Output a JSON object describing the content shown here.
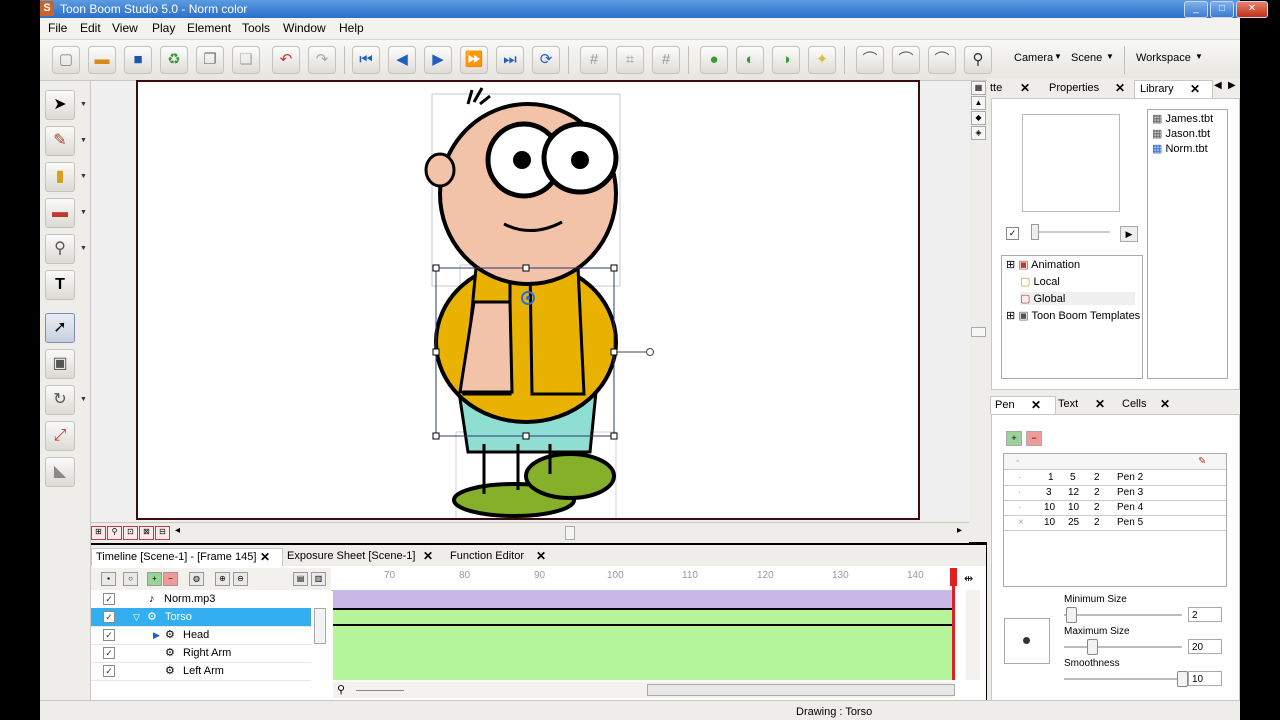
{
  "window": {
    "title": "Toon Boom Studio 5.0 - Norm color",
    "app_icon": "S"
  },
  "menu": [
    "File",
    "Edit",
    "View",
    "Play",
    "Element",
    "Tools",
    "Window",
    "Help"
  ],
  "toolbar": {
    "camera_label": "Camera",
    "scene_label": "Scene",
    "workspace_label": "Workspace"
  },
  "bottom_tabs": {
    "timeline": "Timeline [Scene-1] - [Frame 145]",
    "exposure": "Exposure Sheet [Scene-1]",
    "function": "Function Editor"
  },
  "timeline": {
    "ruler": [
      "70",
      "80",
      "90",
      "100",
      "110",
      "120",
      "130",
      "140"
    ],
    "layers": [
      {
        "name": "Norm.mp3",
        "checked": true
      },
      {
        "name": "Torso",
        "checked": true,
        "selected": true
      },
      {
        "name": "Head",
        "checked": true
      },
      {
        "name": "Right Arm",
        "checked": true
      },
      {
        "name": "Left Arm",
        "checked": true
      }
    ]
  },
  "right_tabs_top": {
    "tab1": "tte",
    "tab2": "Properties",
    "tab3": "Library"
  },
  "library": {
    "files": [
      "James.tbt",
      "Jason.tbt",
      "Norm.tbt"
    ],
    "tree": [
      "Animation",
      "Local",
      "Global",
      "Toon Boom Templates"
    ]
  },
  "right_tabs_bottom": {
    "tab1": "Pen",
    "tab2": "Text",
    "tab3": "Cells"
  },
  "pens": [
    {
      "a": "1",
      "b": "5",
      "c": "2",
      "name": "Pen 2"
    },
    {
      "a": "3",
      "b": "12",
      "c": "2",
      "name": "Pen 3"
    },
    {
      "a": "10",
      "b": "10",
      "c": "2",
      "name": "Pen 4"
    },
    {
      "a": "10",
      "b": "25",
      "c": "2",
      "name": "Pen 5"
    }
  ],
  "pen_settings": {
    "min_label": "Minimum Size",
    "min_value": "2",
    "max_label": "Maximum Size",
    "max_value": "20",
    "smooth_label": "Smoothness",
    "smooth_value": "10"
  },
  "status": {
    "text": "Drawing : Torso"
  },
  "colors": {
    "skin": "#f2c3a8",
    "shirt": "#e9b200",
    "pants": "#8fded2",
    "shoes": "#86b02a",
    "selection": "#33aef0",
    "track": "#b4f59a",
    "sound_track": "#c7b8e8"
  }
}
